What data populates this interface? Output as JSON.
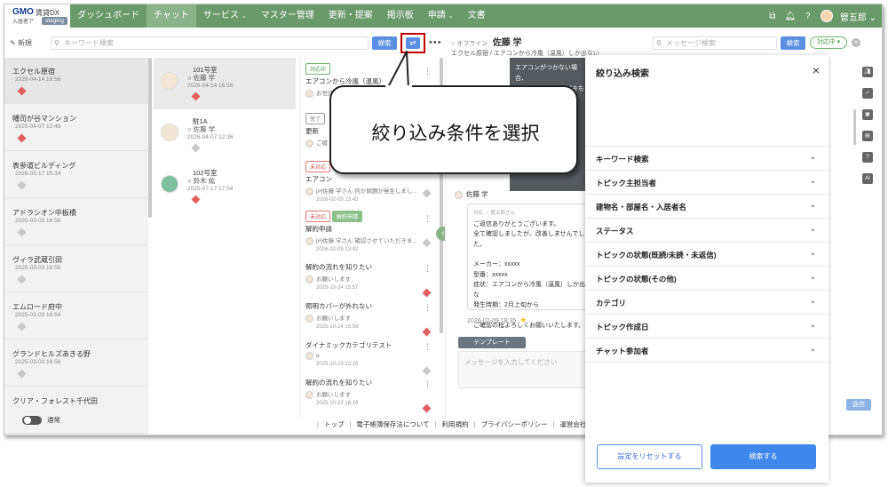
{
  "nav": {
    "logo_gmo": "GMO",
    "logo_dx": "賃貸DX",
    "logo_sub": "入居者ア",
    "staging": "staging",
    "items": [
      "ダッシュボード",
      "チャット",
      "サービス",
      "マスター管理",
      "更新・提案",
      "掲示板",
      "申請",
      "文書"
    ],
    "username": "管五郎"
  },
  "search": {
    "new_label": "新規",
    "keyword_placeholder": "キーワード検索",
    "search_label": "検索",
    "more": "•••",
    "message_placeholder": "メッセージ検索",
    "search_label2": "検索",
    "status_pill": "対応中 ▾"
  },
  "chat_header": {
    "status": "○ オフライン",
    "name": "佐藤 学",
    "sub": "エクセル原宿 / エアコンから冷風（温風）しか出ない"
  },
  "buildings": [
    {
      "name": "エクセル原宿",
      "date": "2026-04-14 16:56",
      "mark": "red"
    },
    {
      "name": "幡司が谷マンション",
      "date": "2025-04-07 12:48",
      "mark": "red"
    },
    {
      "name": "表参道ビルディング",
      "date": "2026-02-17 15:34",
      "mark": "gray"
    },
    {
      "name": "アドラシオン中板橋",
      "date": "2025-03-03 16:56",
      "mark": "gray"
    },
    {
      "name": "ヴィラ武蔵引田",
      "date": "2025-03-03 16:56",
      "mark": "gray"
    },
    {
      "name": "エムロード府中",
      "date": "2025-03-03 16:56",
      "mark": "gray"
    },
    {
      "name": "グランドヒルズあきる野",
      "date": "2025-03-03 16:56",
      "mark": "gray"
    },
    {
      "name": "クリア・フォレスト千代田",
      "date": "",
      "mark": "gray"
    }
  ],
  "toggle_label": "通常",
  "rooms": [
    {
      "no": "101号室",
      "name": "○ 佐藤 学",
      "date": "2026-04-14 16:56",
      "mark": "red"
    },
    {
      "no": "駐1A",
      "name": "○ 佐藤 学",
      "date": "2026-04-07 12:36",
      "mark": "gray"
    },
    {
      "no": "102号室",
      "name": "○ 鈴木 紘",
      "date": "2025-07-17 17:54",
      "mark": "red"
    }
  ],
  "topics": [
    {
      "tags": [
        {
          "t": "対応中",
          "c": "green"
        }
      ],
      "title": "エアコンから冷風（温風）",
      "preview": "お世話",
      "date": "",
      "mark": "red"
    },
    {
      "tags": [
        {
          "t": "完了",
          "c": "gray"
        }
      ],
      "title": "更新",
      "preview": "ご確",
      "date": "",
      "mark": "gray"
    },
    {
      "tags": [
        {
          "t": "未対応",
          "c": "red"
        }
      ],
      "title": "エアコン",
      "preview": "[#]佐藤 学さん 何か問題が発生しまし...",
      "date": "2026-02-09 13:43",
      "mark": "gray"
    },
    {
      "tags": [
        {
          "t": "未対応",
          "c": "red"
        },
        {
          "t": "解約申請",
          "c": "greenfill"
        }
      ],
      "title": "解約申請",
      "preview": "[#]佐藤 学さん 確認させていただきま...",
      "date": "2026-02-09 13:42",
      "mark": "gray"
    },
    {
      "tags": [],
      "title": "解約の流れを知りたい",
      "preview": "お願いします",
      "date": "2025-10-24 15:57",
      "mark": "red"
    },
    {
      "tags": [],
      "title": "照明カバーが外れない",
      "preview": "お願いします",
      "date": "2025-10-24 15:56",
      "mark": "red"
    },
    {
      "tags": [],
      "title": "ダイナミックカテゴリテスト",
      "preview": "a",
      "date": "2025-10-23 12:18",
      "mark": "gray"
    },
    {
      "tags": [],
      "title": "解約の流れを知りたい",
      "preview": "お願いします",
      "date": "2025-10-22 16:19",
      "mark": "red"
    }
  ],
  "chat": {
    "pinned_title": "エアコンがつかない場合、",
    "pinned_line": "1. リモコンの電池がきちん",
    "sender": "佐藤 学",
    "bubble_tags": "対応 ・ 管五郎さん",
    "bubble_lines": [
      "ご返信ありがとうございます。",
      "全て確認しましたが、改善しませんでした。",
      "",
      "メーカー：xxxxx",
      "型番：xxxxx",
      "症状：エアコンから冷風（温風）しか出な",
      "発生時期：2月上旬から",
      "",
      "ご確認の程よろしくお願いいたします。"
    ],
    "time": "2026-02-09 18:35",
    "template_label": "テンプレート",
    "message_placeholder": "メッセージを入力してください",
    "send_label": "送信"
  },
  "strip_icons": [
    "users-icon",
    "check-icon",
    "contact-icon",
    "doc-icon",
    "faq-icon",
    "ai-icon"
  ],
  "footer": [
    "トップ",
    "電子帳簿保存法について",
    "利用規約",
    "プライバシーポリシー",
    "運営会社"
  ],
  "filter_panel": {
    "title": "絞り込み検索",
    "sections": [
      "キーワード検索",
      "トピック主担当者",
      "建物名・部屋名・入居者名",
      "ステータス",
      "トピックの状態(既読/未読・未返信)",
      "トピックの状態(その他)",
      "カテゴリ",
      "トピック作成日",
      "チャット参加者"
    ],
    "reset_label": "設定をリセットする",
    "apply_label": "検索する"
  },
  "callout": {
    "text": "絞り込み条件を選択"
  },
  "colors": {
    "nav_green": "#6b9a6a",
    "primary_blue": "#3f87ea",
    "highlight_red": "#c00000"
  }
}
